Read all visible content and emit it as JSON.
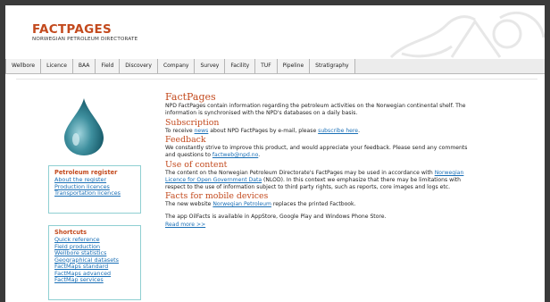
{
  "header": {
    "brand": "FACTPAGES",
    "brand_sub": "NORWEGIAN PETROLEUM DIRECTORATE"
  },
  "tabs": [
    "Wellbore",
    "Licence",
    "BAA",
    "Field",
    "Discovery",
    "Company",
    "Survey",
    "Facility",
    "TUF",
    "Pipeline",
    "Stratigraphy"
  ],
  "sidebar": {
    "petroleum_register": {
      "title": "Petroleum register",
      "links": [
        "About the register",
        "Production licences",
        "Transportation licences"
      ]
    },
    "shortcuts": {
      "title": "Shortcuts",
      "links": [
        "Quick reference",
        "Field production",
        "Wellbore statistics",
        "Geographical datasets",
        "FactMaps standard",
        "FactMaps advanced",
        "FactMap services"
      ]
    }
  },
  "main": {
    "factpages": {
      "title": "FactPages",
      "text": "NPD FactPages contain information regarding the petroleum activities on the Norwegian continental shelf. The information is synchronised with the NPD's databases on a daily basis."
    },
    "subscription": {
      "title": "Subscription",
      "text_a": "To receive ",
      "link_news": "news",
      "text_b": " about NPD FactPages by e-mail, please ",
      "link_subscribe": "subscribe here",
      "text_c": "."
    },
    "feedback": {
      "title": "Feedback",
      "text_a": "We constantly strive to improve this product, and would appreciate your feedback. Please send any comments and questions to ",
      "link_email": "factweb@npd.no",
      "text_b": "."
    },
    "use": {
      "title": "Use of content",
      "text_a": "The content on the Norwegian Petroleum Directorate's FactPages may be used in accordance with ",
      "link_licence": "Norwegian Licence for Open Government Data",
      "text_b": " (NLOD). In this context we emphasize that there may be limitations with respect to the use of information subject to third party rights, such as reports, core images and logs etc."
    },
    "mobile": {
      "title": "Facts for mobile devices",
      "text_a": "The new website ",
      "link_np": "Norwegian Petroleum",
      "text_b": " replaces the printed Factbook.",
      "text_app": "The app OilFacts is available in AppStore, Google Play and Windows Phone Store.",
      "link_more": "Read more >>"
    }
  },
  "colors": {
    "accent": "#c34a1e",
    "link": "#1a6fb6",
    "box_border": "#8fcfd2",
    "drop": "#2f7f8e"
  }
}
